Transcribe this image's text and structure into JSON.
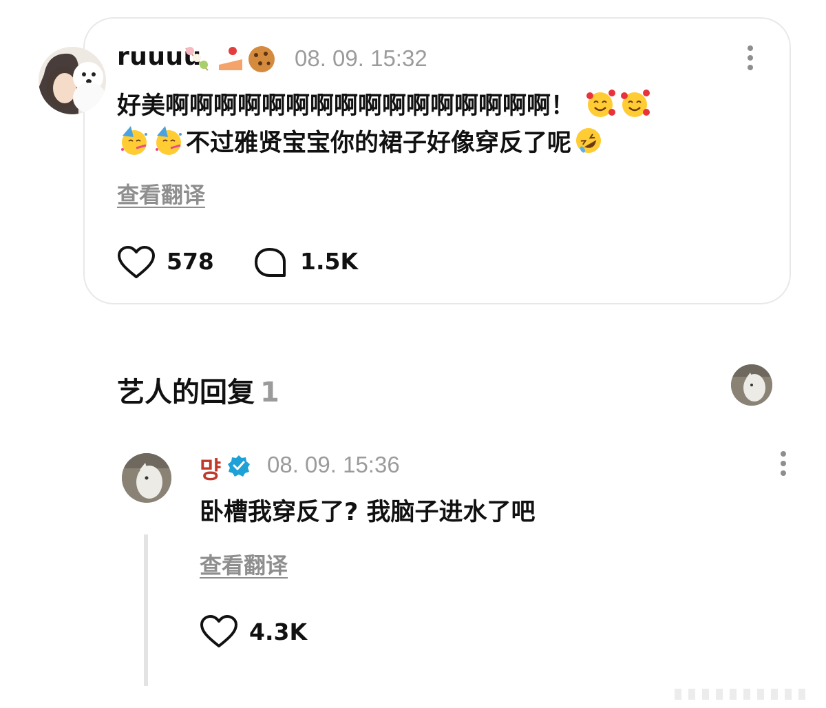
{
  "comment": {
    "username": "ruuuu",
    "name_emojis": [
      "dango-emoji",
      "cake-emoji",
      "cookie-emoji"
    ],
    "timestamp": "08. 09. 15:32",
    "line1": "好美啊啊啊啊啊啊啊啊啊啊啊啊啊啊啊啊！",
    "line2": "不过雅贤宝宝你的裙子好像穿反了呢",
    "translate_label": "查看翻译",
    "likes": "578",
    "replies": "1.5K"
  },
  "artist_replies": {
    "title": "艺人的回复",
    "count": "1"
  },
  "reply": {
    "username": "먕",
    "verified_color": "#1da1d6",
    "timestamp": "08. 09. 15:36",
    "text": "卧槽我穿反了? 我脑子进水了吧",
    "translate_label": "查看翻译",
    "likes": "4.3K"
  },
  "colors": {
    "accent_name": "#c0392b",
    "muted": "#9b9b9b",
    "border": "#e8e8e8"
  }
}
